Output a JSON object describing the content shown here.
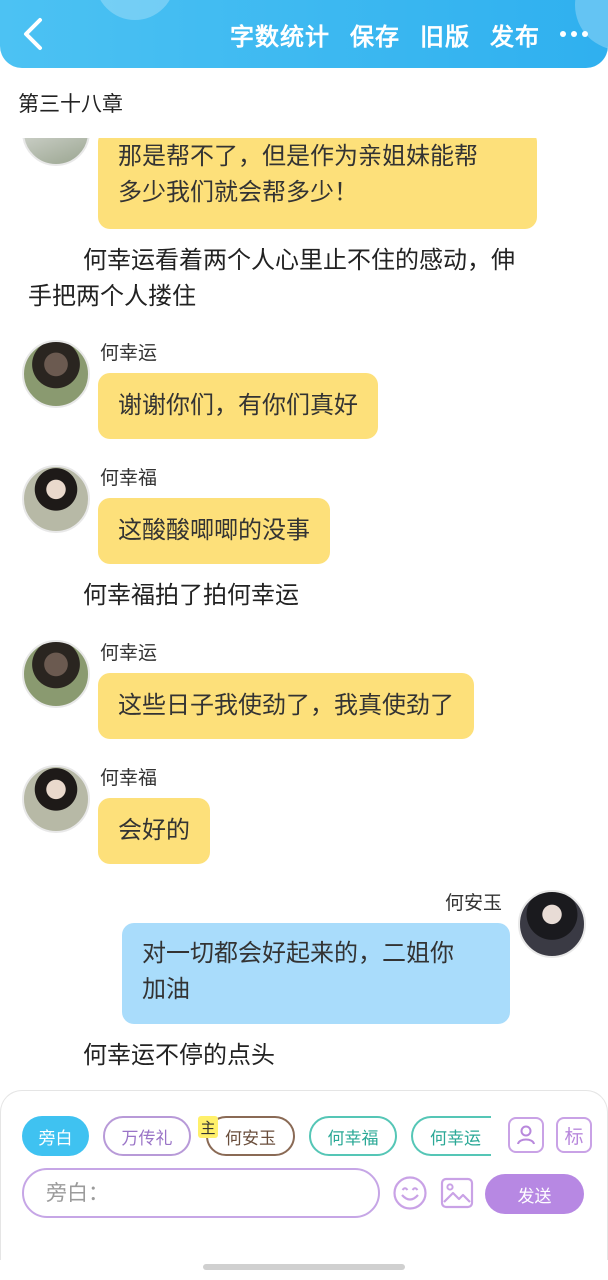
{
  "header": {
    "actions": [
      "字数统计",
      "保存",
      "旧版",
      "发布"
    ],
    "colors": {
      "bar": "#34b4f0"
    }
  },
  "chapter": {
    "title": "第三十八章"
  },
  "messages": {
    "m0": {
      "text_line1": "那是帮不了，但是作为亲姐妹能帮",
      "text_line2": "多少我们就会帮多少！"
    },
    "n1": {
      "line1": "何幸运看着两个人心里止不住的感动，伸",
      "line2": "手把两个人搂住"
    },
    "m1": {
      "sender": "何幸运",
      "text": "谢谢你们，有你们真好"
    },
    "m2": {
      "sender": "何幸福",
      "text": "这酸酸唧唧的没事"
    },
    "n2": {
      "text": "何幸福拍了拍何幸运"
    },
    "m3": {
      "sender": "何幸运",
      "text": "这些日子我使劲了，我真使劲了"
    },
    "m4": {
      "sender": "何幸福",
      "text": "会好的"
    },
    "m5": {
      "sender": "何安玉",
      "text_line1": "对一切都会好起来的，二姐你",
      "text_line2": "加油"
    },
    "n3": {
      "text": "何幸运不停的点头"
    }
  },
  "composer": {
    "roles": [
      "旁白",
      "万传礼",
      "何安玉",
      "何幸福",
      "何幸运"
    ],
    "main_badge": "主",
    "tag_icon_label": "标",
    "input_placeholder": "旁白：",
    "send_label": "发送",
    "colors": {
      "accent_blue": "#3fc2f1",
      "accent_purple": "#b788e3",
      "bubble_yellow": "#fde07a",
      "bubble_blue": "#a9dcfb"
    }
  }
}
